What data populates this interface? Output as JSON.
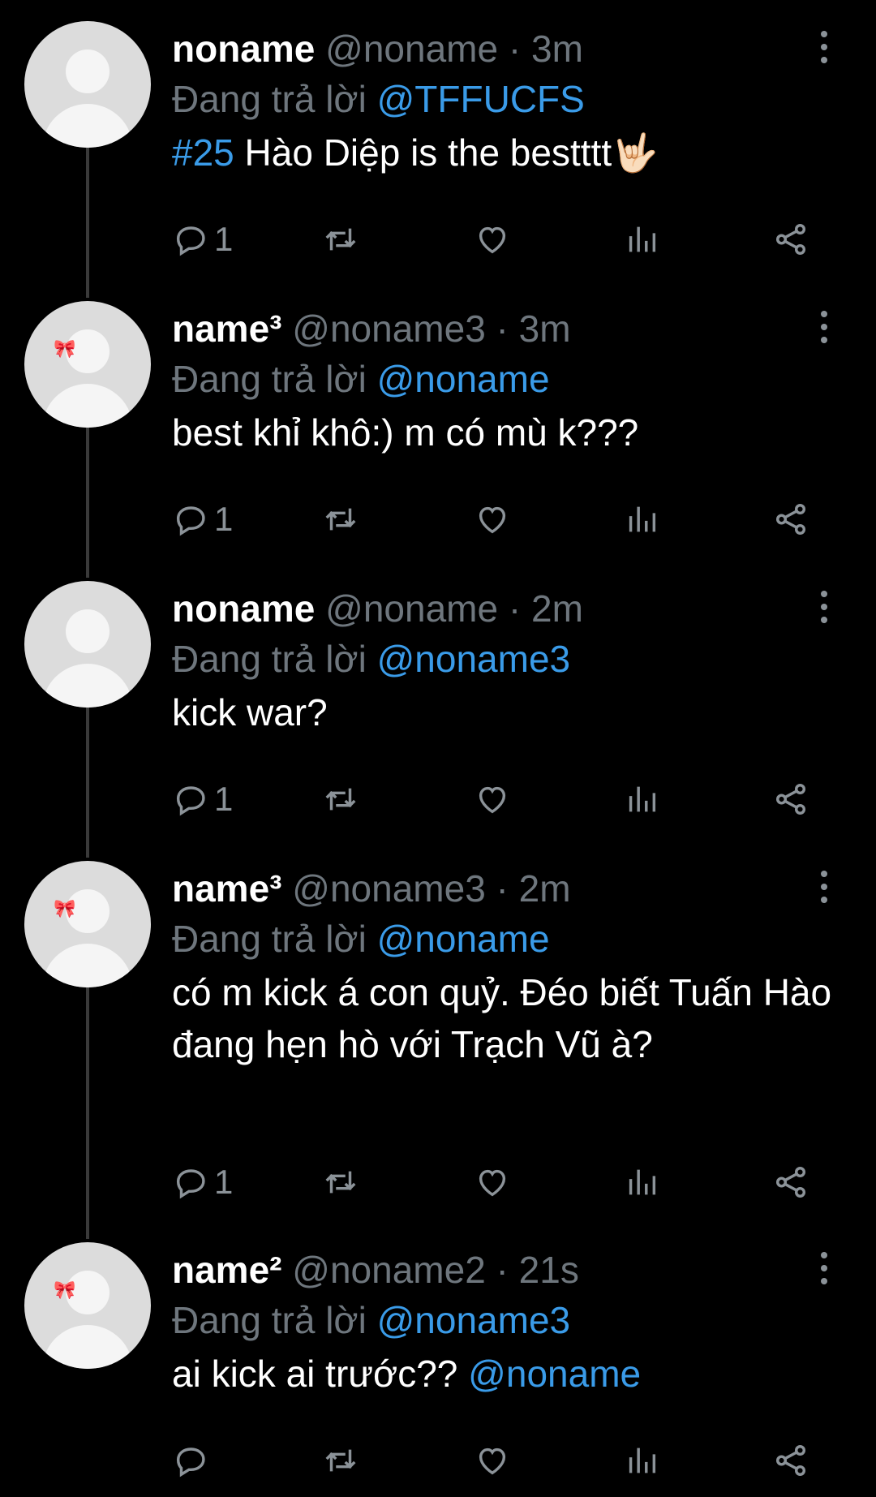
{
  "tweets": [
    {
      "display_name": "noname",
      "handle": "@noname",
      "time": "3m",
      "reply_prefix": "Đang trả lời",
      "reply_to": "@TFFUCFS",
      "text_link": "#25",
      "text": " Hào Diệp is the bestttt🤟🏻",
      "text_suffix_link": "",
      "reply_count": "1",
      "avatar_icon": "default-avatar"
    },
    {
      "display_name": "name³",
      "handle": "@noname3",
      "time": "3m",
      "reply_prefix": "Đang trả lời",
      "reply_to": "@noname",
      "text_link": "",
      "text": "best khỉ khô:) m có mù k???",
      "text_suffix_link": "",
      "reply_count": "1",
      "avatar_icon": "bow-avatar"
    },
    {
      "display_name": "noname",
      "handle": "@noname",
      "time": "2m",
      "reply_prefix": "Đang trả lời",
      "reply_to": "@noname3",
      "text_link": "",
      "text": "kick war?",
      "text_suffix_link": "",
      "reply_count": "1",
      "avatar_icon": "default-avatar"
    },
    {
      "display_name": "name³",
      "handle": "@noname3",
      "time": "2m",
      "reply_prefix": "Đang trả lời",
      "reply_to": "@noname",
      "text_link": "",
      "text": "có m kick á con quỷ. Đéo biết Tuấn Hào đang hẹn hò với Trạch Vũ à?",
      "text_suffix_link": "",
      "reply_count": "1",
      "avatar_icon": "bow-avatar"
    },
    {
      "display_name": "name²",
      "handle": "@noname2",
      "time": "21s",
      "reply_prefix": "Đang trả lời",
      "reply_to": "@noname3",
      "text_link": "",
      "text": "ai kick ai trước?? ",
      "text_suffix_link": "@noname",
      "reply_count": "",
      "avatar_icon": "bow-avatar"
    }
  ],
  "colors": {
    "background": "#000000",
    "link": "#3a9be8",
    "muted": "#6e767d",
    "icon": "#8b9298",
    "thread_line": "#3a3a3a"
  },
  "icons": {
    "reply": "reply-icon",
    "retweet": "retweet-icon",
    "like": "heart-icon",
    "views": "analytics-icon",
    "share": "share-icon",
    "more": "more-options-icon"
  }
}
